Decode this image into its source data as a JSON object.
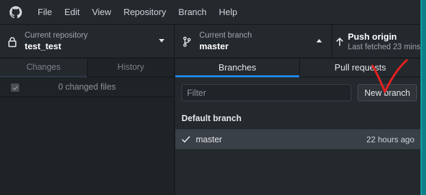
{
  "menu": [
    "File",
    "Edit",
    "View",
    "Repository",
    "Branch",
    "Help"
  ],
  "toolbar": {
    "repo_label": "Current repository",
    "repo_value": "test_test",
    "branch_label": "Current branch",
    "branch_value": "master",
    "push_label": "Push origin",
    "push_sub": "Last fetched 23 mins"
  },
  "sidebar": {
    "tabs": [
      "Changes",
      "History"
    ],
    "changed_files": "0 changed files"
  },
  "branches_panel": {
    "tabs": [
      "Branches",
      "Pull requests"
    ],
    "filter_placeholder": "Filter",
    "new_branch_label": "New branch",
    "section_header": "Default branch",
    "branches": [
      {
        "name": "master",
        "time": "22 hours ago",
        "selected": true
      }
    ]
  },
  "colors": {
    "accent": "#2486e8",
    "background": "#24292e",
    "annotation": "#e8201e"
  },
  "icons": {
    "logo": "github-logo-icon",
    "repo": "lock-icon",
    "branch": "git-branch-icon",
    "push": "arrow-up-icon",
    "check": "check-icon"
  }
}
